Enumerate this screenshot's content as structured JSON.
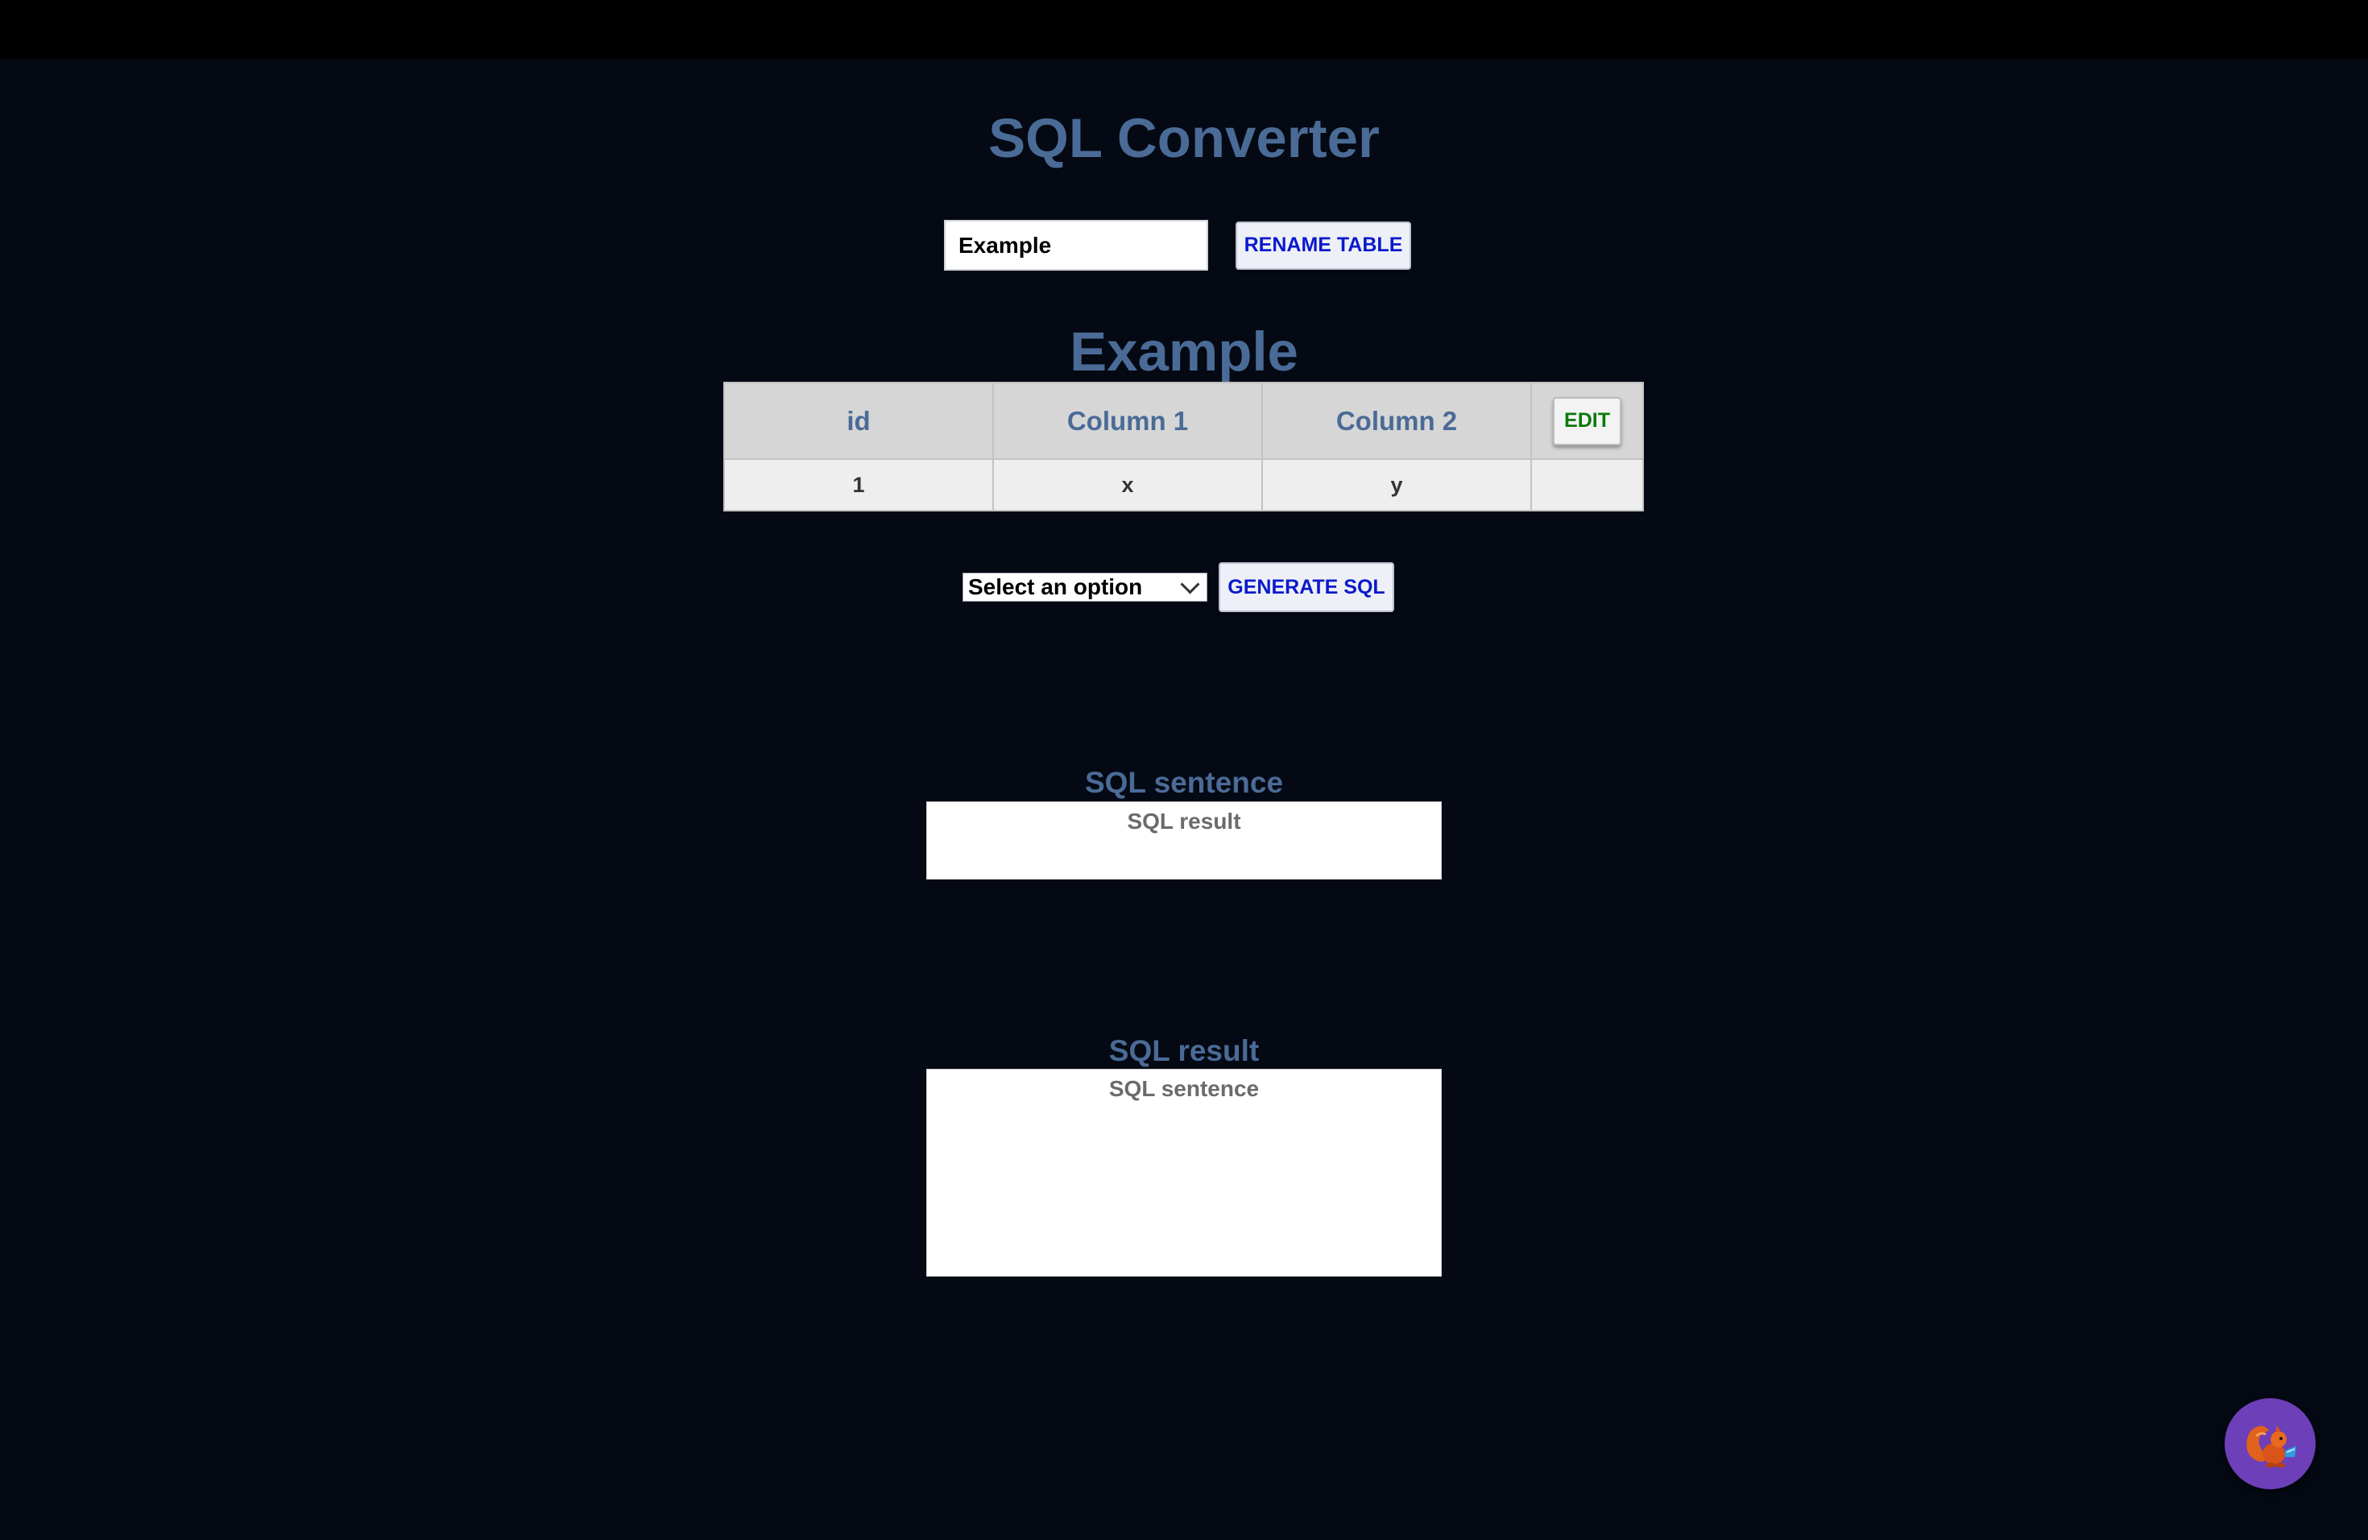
{
  "app": {
    "title": "SQL Converter"
  },
  "rename": {
    "input_value": "Example",
    "button_label": "RENAME TABLE"
  },
  "table": {
    "name": "Example",
    "columns": [
      "id",
      "Column 1",
      "Column 2"
    ],
    "edit_label": "EDIT",
    "rows": [
      [
        "1",
        "x",
        "y"
      ]
    ]
  },
  "generate": {
    "select_value": "Select an option",
    "button_label": "GENERATE SQL"
  },
  "sql_sentence": {
    "heading": "SQL sentence",
    "placeholder": "SQL result"
  },
  "sql_result": {
    "heading": "SQL result",
    "placeholder": "SQL sentence"
  },
  "assistant": {
    "icon": "squirrel-icon",
    "colors": {
      "background": "#6d3fb8"
    }
  },
  "colors": {
    "page_background": "#040913",
    "heading": "#4a6b96",
    "button_text": "#0a1acc",
    "edit_text": "#0a7a0a"
  }
}
